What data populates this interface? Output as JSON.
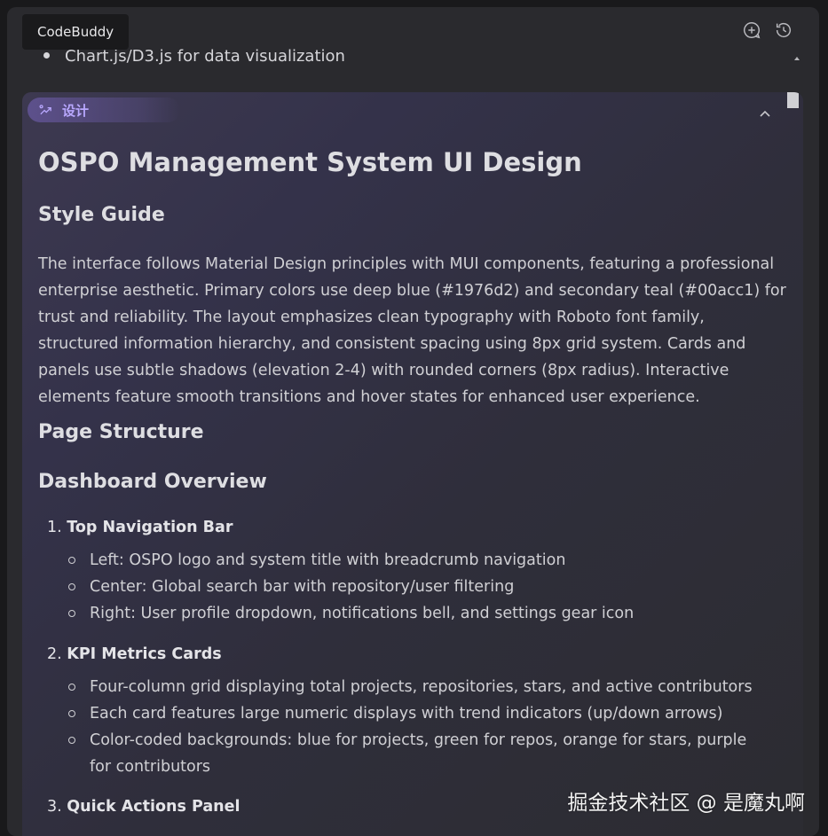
{
  "app": {
    "tooltip": "CodeBuddy",
    "header_icons": [
      "new-chat-icon",
      "history-icon"
    ]
  },
  "prev_message": {
    "bullet": "Chart.js/D3.js for data visualization"
  },
  "card": {
    "chip_label": "设计",
    "chip_icon": "design-icon",
    "title": "OSPO Management System UI Design",
    "style_guide_heading": "Style Guide",
    "style_guide_text": "The interface follows Material Design principles with MUI components, featuring a professional enterprise aesthetic. Primary colors use deep blue (#1976d2) and secondary teal (#00acc1) for trust and reliability. The layout emphasizes clean typography with Roboto font family, structured information hierarchy, and consistent spacing using 8px grid system. Cards and panels use subtle shadows (elevation 2-4) with rounded corners (8px radius). Interactive elements feature smooth transitions and hover states for enhanced user experience.",
    "page_structure_heading": "Page Structure",
    "dashboard_heading": "Dashboard Overview",
    "sections": [
      {
        "number": "1.",
        "title": "Top Navigation Bar",
        "items": [
          "Left: OSPO logo and system title with breadcrumb navigation",
          "Center: Global search bar with repository/user filtering",
          "Right: User profile dropdown, notifications bell, and settings gear icon"
        ]
      },
      {
        "number": "2.",
        "title": "KPI Metrics Cards",
        "items": [
          "Four-column grid displaying total projects, repositories, stars, and active contributors",
          "Each card features large numeric displays with trend indicators (up/down arrows)",
          "Color-coded backgrounds: blue for projects, green for repos, orange for stars, purple for contributors"
        ]
      },
      {
        "number": "3.",
        "title": "Quick Actions Panel",
        "items": []
      }
    ]
  },
  "watermark": "掘金技术社区 @ 是魔丸啊",
  "colors": {
    "background": "#19191b",
    "panel": "#2a2a2e",
    "accent": "#b9a8ff"
  }
}
